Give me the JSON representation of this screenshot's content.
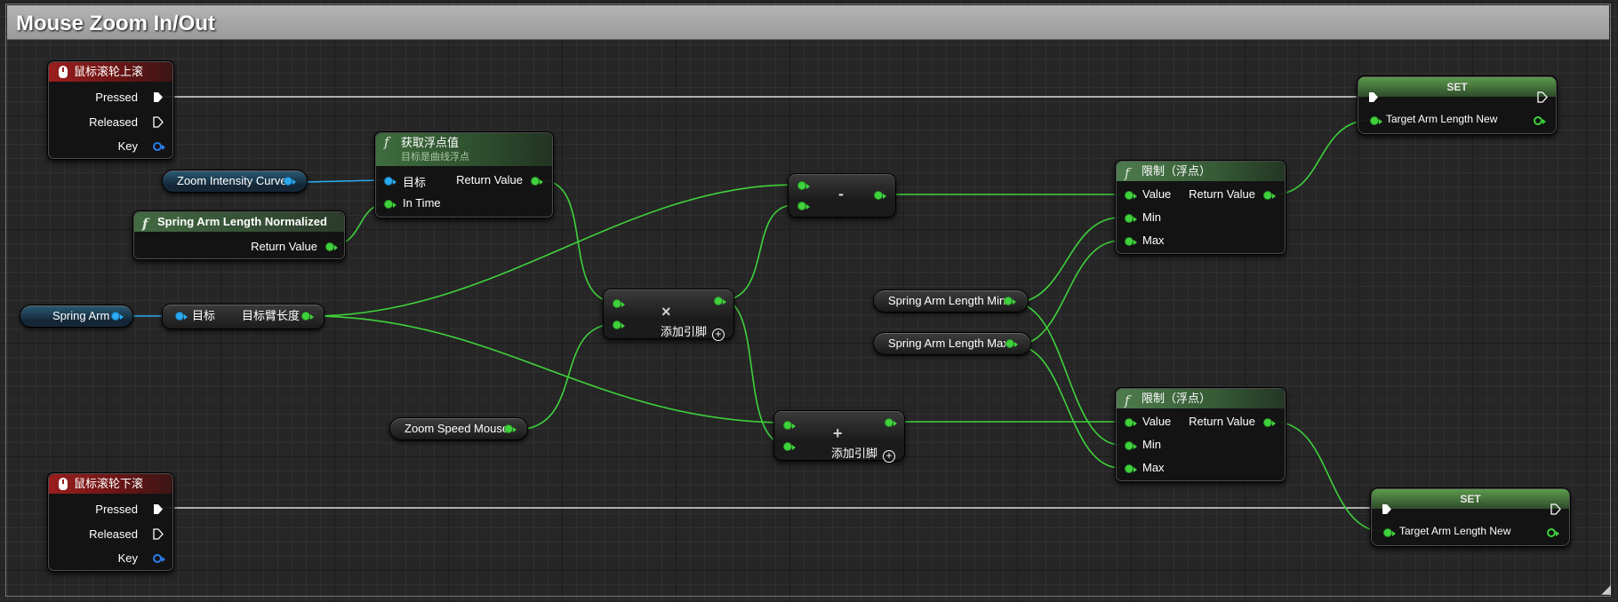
{
  "comment": {
    "title": "Mouse Zoom In/Out"
  },
  "colors": {
    "exec_wire": "#e0e0e0",
    "float_wire": "#3fd23c",
    "object_wire": "#2aa9ef"
  },
  "events": {
    "wheel_up": {
      "title": "鼠标滚轮上滚",
      "pressed": "Pressed",
      "released": "Released",
      "key": "Key"
    },
    "wheel_down": {
      "title": "鼠标滚轮下滚",
      "pressed": "Pressed",
      "released": "Released",
      "key": "Key"
    }
  },
  "get_float": {
    "title": "获取浮点值",
    "subtitle": "目标是曲线浮点",
    "target": "目标",
    "in_time": "In Time",
    "return_value": "Return Value"
  },
  "variables": {
    "zoom_intensity_curve": "Zoom Intensity Curve",
    "spring_arm": "Spring Arm",
    "zoom_speed_mouse": "Zoom Speed Mouse",
    "spring_arm_length_min": "Spring Arm Length Min",
    "spring_arm_length_max": "Spring Arm Length Max"
  },
  "spring_arm_normalized": {
    "title": "Spring Arm Length Normalized",
    "return_value": "Return Value"
  },
  "target_arm_length_getter": {
    "target": "目标",
    "output": "目标臂长度"
  },
  "multiply": {
    "op": "×",
    "add_pin": "添加引脚"
  },
  "subtract": {
    "op": "-"
  },
  "add": {
    "op": "+",
    "add_pin": "添加引脚"
  },
  "clamp_top": {
    "title": "限制（浮点）",
    "value": "Value",
    "min": "Min",
    "max": "Max",
    "return_value": "Return Value"
  },
  "clamp_bottom": {
    "title": "限制（浮点）",
    "value": "Value",
    "min": "Min",
    "max": "Max",
    "return_value": "Return Value"
  },
  "set_top": {
    "title": "SET",
    "field": "Target Arm Length New"
  },
  "set_bottom": {
    "title": "SET",
    "field": "Target Arm Length New"
  }
}
